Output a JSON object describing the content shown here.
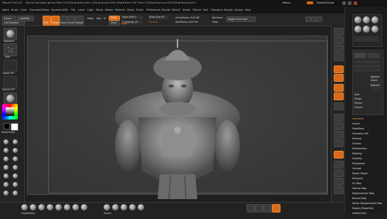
{
  "title": {
    "left": "ZBrush 2022.0.5",
    "center": "ZBrush Document  ▪ Free Mem 23.55GB ▪ Active Mem 1476 ▪ Scratch Disk 38 ▪ RTime 0.09 Timer 0.008 ▪ PolyCount 8.83 MP ▪ MeshCount 1",
    "right_menu": "Menus",
    "right_script": "DefaultZScript"
  },
  "menu": [
    "Alpha",
    "Brush",
    "Color",
    "Document",
    "Draw",
    "Dynamics",
    "Edit",
    "File",
    "Layer",
    "Light",
    "Macro",
    "Marker",
    "Material",
    "Movie",
    "Picker",
    "Preferences",
    "Render",
    "Stencil",
    "Stroke",
    "Texture",
    "Tool",
    "Transform",
    "Zplugin",
    "Zscript",
    "Help"
  ],
  "toolbar": {
    "home": "Home",
    "lightbox": "LightBox",
    "live_boolean": "Live Boolean",
    "edit": "Edit",
    "draw": "Draw",
    "move": "Move",
    "scale": "Scale",
    "rotate": "Rotate",
    "mrgb": "Mrgb",
    "rgb": "Rgb",
    "m": "M",
    "zadd": "Zadd",
    "zsub": "Zsub",
    "focal_shift": "Focal Shift 0",
    "z_intensity": "Z Intensity 25",
    "draw_size": "Draw Size 64",
    "dynamic": "Dynamic",
    "active_points": "ActivePoints: 8.83 Mil",
    "total_points": "TotalPoints: 8.83 Mil",
    "rgb_intensity": "Rgb Intensity 100",
    "adjust_last": "AdjustLast 1",
    "backface": "Backface",
    "mask": "Mask",
    "toggle_auto_save": "Toggle Auto Save"
  },
  "left_shelf": {
    "standard": "Standard",
    "dots": "Dots",
    "alpha_off": "Alpha Off",
    "texture_off": "Texture Off",
    "material": "MatCap Gray",
    "gradient": "Gradient",
    "switch_color": "SwitchColor",
    "alternate": "Alternate"
  },
  "right_shelf": [
    "BPR",
    "SPix 3",
    "Scroll",
    "Zoom",
    "Actual",
    "AAHalf",
    "Persp",
    "Floor",
    "Local",
    "Frame",
    "Move",
    "Scale",
    "Rotate",
    "Line Fill",
    "PolyF",
    "Transp",
    "Ghost",
    "Solo",
    "Xpose"
  ],
  "tray": {
    "tool_label": "Tool",
    "items_top": [
      "Load Tool",
      "Save As",
      "Copy Tool",
      "Paste Tool",
      "Import",
      "Export",
      "Clone",
      "Make PolyMesh3D",
      "GoZ",
      "All",
      "Visible"
    ],
    "subtool_labels": [
      "SubTool",
      "Append",
      "Insert",
      "Split",
      "Merge",
      "Remesh",
      "Project",
      "Extract"
    ],
    "items": [
      "Geometry",
      "Layers",
      "FiberMesh",
      "Geometry HD",
      "Preview",
      "Surface",
      "Deformation",
      "Masking",
      "Visibility",
      "Polygroups",
      "Contact",
      "Morph Target",
      "Polypaint",
      "UV Map",
      "Texture Map",
      "Displacement Map",
      "Normal Map",
      "Vector Displacement Map",
      "Display Properties",
      "Unified Skin",
      "Initialize",
      "Import",
      "Export"
    ]
  },
  "bottom": {
    "brushes": [
      "ClayBuildup",
      "DamStandard",
      "Inflate",
      "Move",
      "Pinch",
      "Standard",
      "TrimDynamic",
      "hPolish",
      "Slash3",
      "Orb_Cracks",
      "Clay",
      "Blob"
    ],
    "right_icons": [
      "Transpose",
      "Gizmo",
      "Sculptris Pro",
      "Edit"
    ]
  },
  "colors": {
    "accent": "#d86a18",
    "canvas": "#3c3c3c",
    "panel": "#242424"
  }
}
